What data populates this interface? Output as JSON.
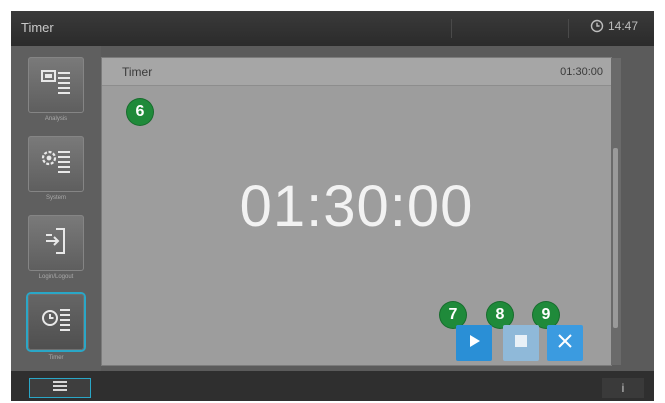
{
  "header": {
    "title": "Timer",
    "clock": "14:47"
  },
  "sidebar": {
    "items": [
      {
        "label": "Analysis",
        "icon": "analysis-icon"
      },
      {
        "label": "System",
        "icon": "system-icon"
      },
      {
        "label": "Login/Logout",
        "icon": "login-logout-icon"
      },
      {
        "label": "Timer",
        "icon": "timer-icon",
        "active": true
      }
    ]
  },
  "dialog": {
    "title": "Timer",
    "header_time": "01:30:00",
    "countdown": "01:30:00"
  },
  "callouts": {
    "six": "6",
    "seven": "7",
    "eight": "8",
    "nine": "9"
  },
  "bottombar": {
    "info": "i"
  },
  "colors": {
    "accent": "#2aa7c7",
    "badge": "#1f8a3a",
    "play": "#2a8fd6",
    "stop": "#8fb9d9",
    "close": "#3b9be0"
  }
}
